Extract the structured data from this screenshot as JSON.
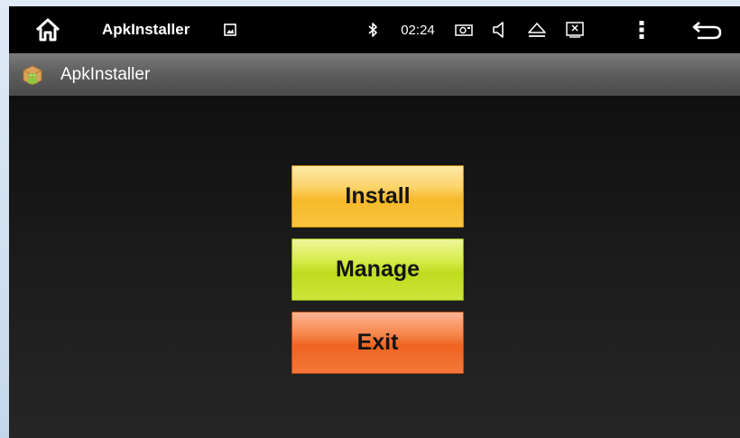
{
  "statusbar": {
    "app_name": "ApkInstaller",
    "time": "02:24",
    "icons": [
      "home-icon",
      "image-icon",
      "bluetooth-icon",
      "camera-icon",
      "volume-icon",
      "eject-icon",
      "close-box-icon",
      "more-vert-icon",
      "back-icon"
    ]
  },
  "actionbar": {
    "title": "ApkInstaller",
    "icon": "apk-package-icon"
  },
  "buttons": {
    "install": "Install",
    "manage": "Manage",
    "exit": "Exit"
  },
  "colors": {
    "install": "#f7b92a",
    "manage": "#bfdc1e",
    "exit": "#ef6320"
  }
}
